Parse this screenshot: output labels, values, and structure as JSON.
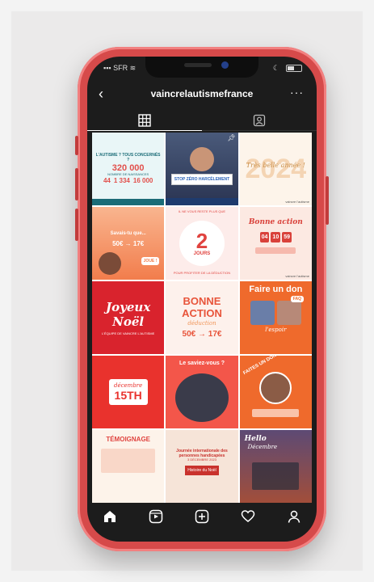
{
  "status_bar": {
    "carrier": "SFR"
  },
  "header": {
    "username": "vaincrelautismefrance"
  },
  "icons": {
    "back": "back-arrow-icon",
    "more": "more-options-icon",
    "grid_tab": "grid-icon",
    "tagged_tab": "tagged-icon",
    "nav": [
      "home-icon",
      "reels-icon",
      "new-post-icon",
      "activity-heart-icon",
      "profile-icon"
    ]
  },
  "posts": {
    "p1": {
      "title": "L'AUTISME ? TOUS CONCERNÉS ?",
      "number": "320 000",
      "sub": "NOMBRE DE NAISSANCES",
      "n1": "44",
      "n2": "1 334",
      "n3": "16 000"
    },
    "p2": {
      "sign": "STOP ZÉRO HARCÈLEMENT"
    },
    "p3": {
      "year": "2024",
      "script": "Très belle année !"
    },
    "p4": {
      "title": "Savais-tu que...",
      "price": "50€ → 17€",
      "tag": "JOUE !"
    },
    "p5": {
      "top": "IL NE VOUS RESTE PLUS QUE",
      "big": "2",
      "unit": "JOURS",
      "bottom": "POUR PROFITER DE LA DÉDUCTION"
    },
    "p6": {
      "title": "Bonne action",
      "countdown": [
        "04",
        "10",
        "59"
      ]
    },
    "p7": {
      "script1": "Joyeux",
      "script2": "Noël",
      "sub": "L'ÉQUIPE DE VAINCRE L'AUTISME"
    },
    "p8": {
      "title1": "BONNE",
      "title2": "ACTION",
      "script": "déduction",
      "price": "50€ → 17€"
    },
    "p9": {
      "title": "Faire un don",
      "faq": "FAQ",
      "script": "l'espoir"
    },
    "p10": {
      "month": "décembre",
      "day": "15TH"
    },
    "p11": {
      "title": "Le saviez-vous ?"
    },
    "p12": {
      "title": "FAITES UN DON"
    },
    "p13": {
      "title": "TÉMOIGNAGE"
    },
    "p14": {
      "title": "Journée internationale des personnes handicapées",
      "date": "3 DÉCEMBRE 2023",
      "box": "Histoire du Noël"
    },
    "p15": {
      "script1": "Hello",
      "script2": "Décembre"
    },
    "logo": "vaincre l'autisme"
  }
}
